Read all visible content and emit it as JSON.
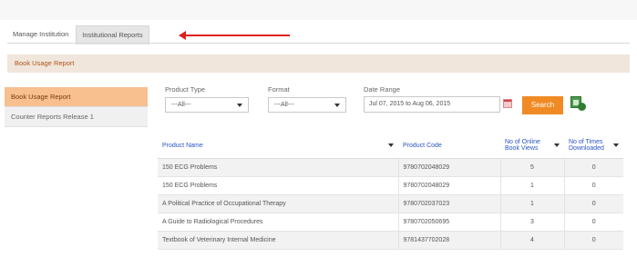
{
  "tabs": [
    {
      "label": "Manage Institution",
      "active": false
    },
    {
      "label": "Institutional Reports",
      "active": true
    }
  ],
  "section_title": "Book Usage Report",
  "sidebar": {
    "items": [
      {
        "label": "Book Usage Report",
        "active": true
      },
      {
        "label": "Counter Reports Release 1",
        "active": false
      }
    ]
  },
  "filters": {
    "product_type": {
      "label": "Product Type",
      "value": "---All---"
    },
    "format": {
      "label": "Format",
      "value": "---All---"
    },
    "date_range": {
      "label": "Date Range",
      "value": "Jul 07, 2015 to Aug 06, 2015"
    },
    "search_label": "Search"
  },
  "table": {
    "headers": {
      "product_name": "Product Name",
      "product_code": "Product Code",
      "online_views": "No of Online Book Views",
      "downloads": "No of Times Downloaded"
    },
    "rows": [
      {
        "name": "150 ECG Problems",
        "code": "9780702048029",
        "views": "5",
        "downloads": "0"
      },
      {
        "name": "150 ECG Problems",
        "code": "9780702048029",
        "views": "1",
        "downloads": "0"
      },
      {
        "name": "A Political Practice of Occupational Therapy",
        "code": "9780702037023",
        "views": "1",
        "downloads": "0"
      },
      {
        "name": "A Guide to Radiological Procedures",
        "code": "9780702050695",
        "views": "3",
        "downloads": "0"
      },
      {
        "name": "Textbook of Veterinary Internal Medicine",
        "code": "9781437702028",
        "views": "4",
        "downloads": "0"
      }
    ]
  },
  "colors": {
    "accent": "#f08a24",
    "section_bar": "#f1e6dc",
    "sidebar_active": "#f7c08e",
    "link_blue": "#2a55c5",
    "annotation_arrow": "#e02020"
  },
  "icons": [
    "calendar-icon",
    "excel-export-icon",
    "sort-caret-icon",
    "dropdown-caret-icon",
    "annotation-arrow"
  ]
}
